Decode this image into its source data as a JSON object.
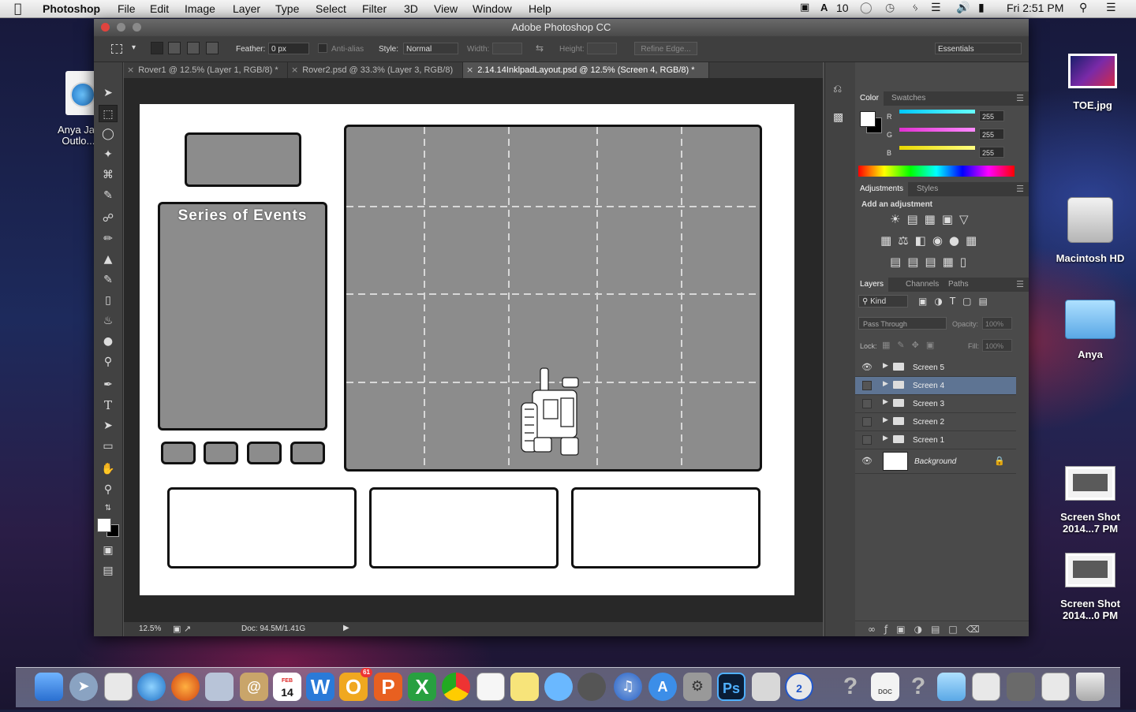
{
  "menubar": {
    "app": "Photoshop",
    "items": [
      "File",
      "Edit",
      "Image",
      "Layer",
      "Type",
      "Select",
      "Filter",
      "3D",
      "View",
      "Window",
      "Help"
    ],
    "status_count": "10",
    "clock": "Fri 2:51 PM"
  },
  "window": {
    "title": "Adobe Photoshop CC"
  },
  "options": {
    "feather_label": "Feather:",
    "feather_value": "0 px",
    "antialias_label": "Anti-alias",
    "style_label": "Style:",
    "style_value": "Normal",
    "width_label": "Width:",
    "height_label": "Height:",
    "refine_edge": "Refine Edge...",
    "workspace": "Essentials"
  },
  "tabs": [
    {
      "label": "Rover1 @ 12.5% (Layer 1, RGB/8) *"
    },
    {
      "label": "Rover2.psd @ 33.3% (Layer 3, RGB/8)"
    },
    {
      "label": "2.14.14InklpadLayout.psd @ 12.5% (Screen 4, RGB/8) *"
    }
  ],
  "canvas": {
    "panel_title": "Series of Events"
  },
  "status": {
    "zoom": "12.5%",
    "doc": "Doc: 94.5M/1.41G"
  },
  "color_panel": {
    "tabs": [
      "Color",
      "Swatches"
    ],
    "channels": [
      {
        "label": "R",
        "value": "255",
        "color": "#00d8e8"
      },
      {
        "label": "G",
        "value": "255",
        "color": "#e83cc8"
      },
      {
        "label": "B",
        "value": "255",
        "color": "#f0e020"
      }
    ]
  },
  "adjustments_panel": {
    "tabs": [
      "Adjustments",
      "Styles"
    ],
    "hint": "Add an adjustment"
  },
  "layers_panel": {
    "tabs": [
      "Layers",
      "Channels",
      "Paths"
    ],
    "kind": "Kind",
    "blend_mode": "Pass Through",
    "opacity_label": "Opacity:",
    "opacity_value": "100%",
    "lock_label": "Lock:",
    "fill_label": "Fill:",
    "fill_value": "100%",
    "layers": [
      {
        "name": "Screen 5",
        "visible": true
      },
      {
        "name": "Screen 4",
        "visible": false,
        "selected": true
      },
      {
        "name": "Screen 3",
        "visible": false
      },
      {
        "name": "Screen 2",
        "visible": false
      },
      {
        "name": "Screen 1",
        "visible": false
      }
    ],
    "background": "Background"
  },
  "desktop": {
    "left_icon_label": "Anya Jacc Outlo...b",
    "icons": [
      {
        "label": "TOE.jpg"
      },
      {
        "label": "Macintosh HD"
      },
      {
        "label": "Anya"
      },
      {
        "label": "Screen Shot 2014...7 PM"
      },
      {
        "label": "Screen Shot 2014...0 PM"
      }
    ]
  },
  "dock": {
    "calendar_day": "14",
    "calendar_month": "FEB",
    "ps_label": "Ps",
    "word_label": "W",
    "outlook_label": "O",
    "powerpoint_label": "P",
    "excel_label": "X",
    "badge": "61",
    "clock_badge": "2",
    "doc_label": "DOC"
  }
}
